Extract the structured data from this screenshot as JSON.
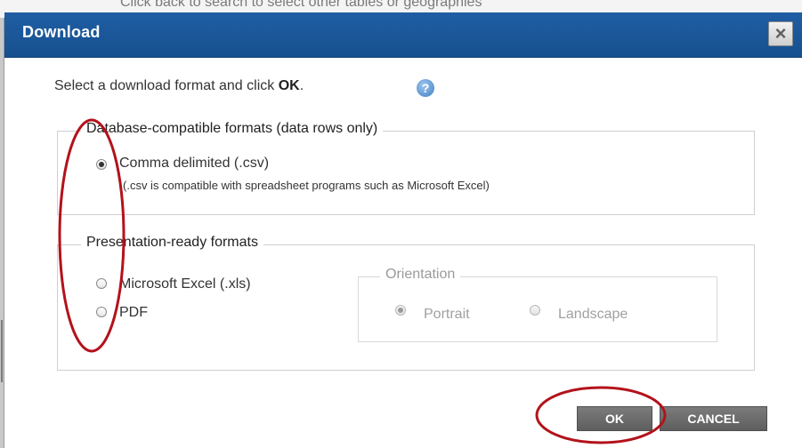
{
  "background": {
    "partial_text": "Click back to search to select other tables or geographies"
  },
  "dialog": {
    "title": "Download",
    "close_icon": "close-icon",
    "instruction_prefix": "Select a download format and click ",
    "instruction_ok": "OK",
    "instruction_suffix": ".",
    "help_icon": "help-icon",
    "help_glyph": "?"
  },
  "database_formats": {
    "legend": "Database-compatible formats (data rows only)",
    "options": [
      {
        "label": "Comma delimited (.csv)",
        "note": "(.csv is compatible with spreadsheet programs such as Microsoft Excel)",
        "checked": true
      }
    ]
  },
  "presentation_formats": {
    "legend": "Presentation-ready formats",
    "options": [
      {
        "label": "Microsoft Excel (.xls)",
        "checked": false
      },
      {
        "label": "PDF",
        "checked": false
      }
    ]
  },
  "orientation": {
    "legend": "Orientation",
    "disabled": true,
    "options": [
      {
        "label": "Portrait",
        "checked": true
      },
      {
        "label": "Landscape",
        "checked": false
      }
    ]
  },
  "buttons": {
    "ok": "OK",
    "cancel": "CANCEL"
  },
  "colors": {
    "titlebar": "#1f5ea3",
    "annotation": "#b3121b",
    "button": "#6d6d6d"
  }
}
